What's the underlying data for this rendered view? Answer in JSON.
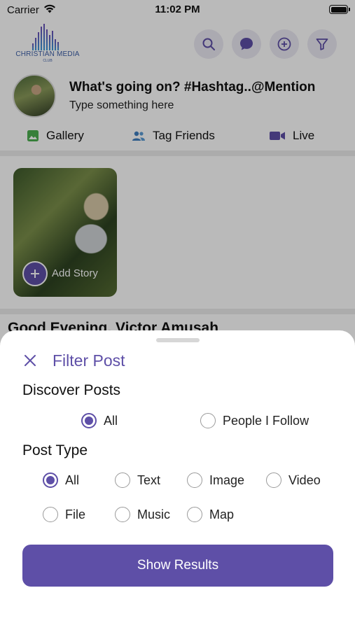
{
  "status_bar": {
    "carrier": "Carrier",
    "time": "11:02 PM"
  },
  "header": {
    "logo_text": "CHRISTIAN MEDIA",
    "logo_sub": "CLUB",
    "icons": [
      "search-icon",
      "chat-icon",
      "add-circle-icon",
      "filter-icon"
    ]
  },
  "composer": {
    "title": "What's going on? #Hashtag..@Mention",
    "subtitle": "Type something here",
    "actions": [
      {
        "label": "Gallery",
        "icon": "gallery-icon",
        "color": "#4caf50"
      },
      {
        "label": "Tag Friends",
        "icon": "tag-friends-icon",
        "color": "#3f7fbf"
      },
      {
        "label": "Live",
        "icon": "live-video-icon",
        "color": "#5e4fa7"
      }
    ]
  },
  "story": {
    "add_label": "Add Story"
  },
  "feed": {
    "greeting": "Good Evening, Victor Amusah"
  },
  "filter_sheet": {
    "title": "Filter Post",
    "discover_title": "Discover Posts",
    "discover_options": [
      {
        "label": "All",
        "selected": true
      },
      {
        "label": "People I Follow",
        "selected": false
      }
    ],
    "post_type_title": "Post Type",
    "post_type_options": [
      {
        "label": "All",
        "selected": true
      },
      {
        "label": "Text",
        "selected": false
      },
      {
        "label": "Image",
        "selected": false
      },
      {
        "label": "Video",
        "selected": false
      },
      {
        "label": "File",
        "selected": false
      },
      {
        "label": "Music",
        "selected": false
      },
      {
        "label": "Map",
        "selected": false
      }
    ],
    "button_label": "Show Results"
  },
  "colors": {
    "accent": "#5e4fa7",
    "overlay": "rgba(0,0,0,0.27)"
  }
}
